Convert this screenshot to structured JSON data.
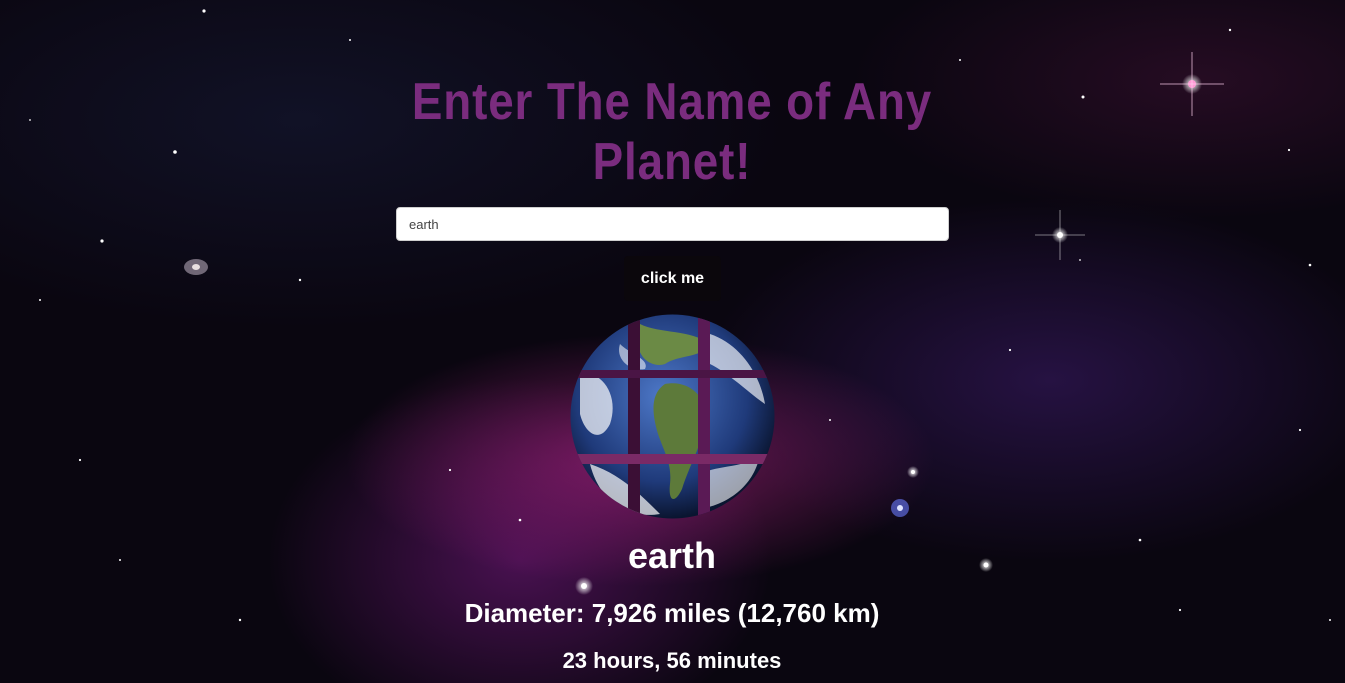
{
  "header": {
    "title": "Enter The Name of Any Planet!"
  },
  "search": {
    "value": "earth",
    "button_label": "click me"
  },
  "result": {
    "name": "earth",
    "image_icon": "earth-planet-image",
    "diameter": "Diameter: 7,926 miles (12,760 km)",
    "day_length": "23 hours, 56 minutes"
  },
  "colors": {
    "title": "#7a2c7e",
    "button_bg": "#0b070c",
    "text": "#ffffff",
    "space_bg": "#0a0610"
  }
}
